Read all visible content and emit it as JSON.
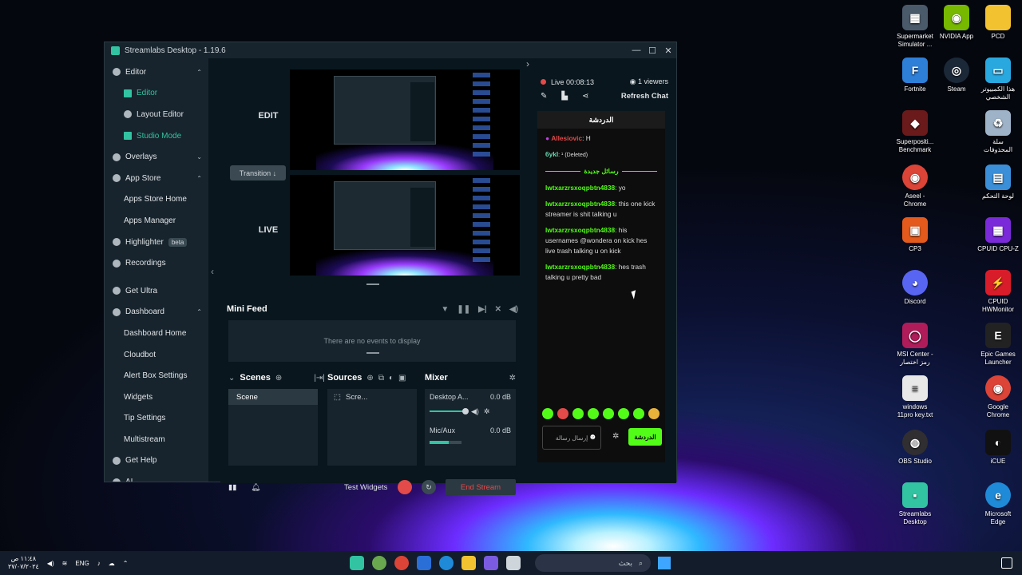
{
  "window": {
    "title": "Streamlabs Desktop - 1.19.6",
    "controls": [
      "—",
      "☐",
      "✕"
    ]
  },
  "sidebar": {
    "items": [
      {
        "label": "Editor",
        "level": 0,
        "caret": "⌃"
      },
      {
        "label": "Editor",
        "level": 1,
        "active": true
      },
      {
        "label": "Layout Editor",
        "level": 1
      },
      {
        "label": "Studio Mode",
        "level": 1,
        "active": true
      },
      {
        "label": "Overlays",
        "level": 0,
        "caret": "⌄"
      },
      {
        "label": "App Store",
        "level": 0,
        "caret": "⌃"
      },
      {
        "label": "Apps Store Home",
        "level": 1
      },
      {
        "label": "Apps Manager",
        "level": 1
      },
      {
        "label": "Highlighter",
        "level": 0,
        "badge": "beta"
      },
      {
        "label": "Recordings",
        "level": 0
      },
      {
        "label": "Get Ultra",
        "level": 0
      },
      {
        "label": "Dashboard",
        "level": 0,
        "caret": "⌃"
      },
      {
        "label": "Dashboard Home",
        "level": 1
      },
      {
        "label": "Cloudbot",
        "level": 1
      },
      {
        "label": "Alert Box Settings",
        "level": 1
      },
      {
        "label": "Widgets",
        "level": 1
      },
      {
        "label": "Tip Settings",
        "level": 1
      },
      {
        "label": "Multistream",
        "level": 1
      },
      {
        "label": "Get Help",
        "level": 0
      },
      {
        "label": "AI",
        "level": 0
      }
    ]
  },
  "studio": {
    "edit_label": "EDIT",
    "live_label": "LIVE",
    "transition_label": "Transition ↓"
  },
  "minifeed": {
    "title": "Mini Feed",
    "empty_text": "There are no events to display"
  },
  "scenes": {
    "title": "Scenes",
    "items": [
      "Scene"
    ]
  },
  "sources": {
    "title": "Sources",
    "items": [
      "Scre..."
    ]
  },
  "mixer": {
    "title": "Mixer",
    "channels": [
      {
        "name": "Desktop A...",
        "db": "0.0 dB"
      },
      {
        "name": "Mic/Aux",
        "db": "0.0 dB"
      }
    ]
  },
  "footer": {
    "test_widgets": "Test Widgets",
    "end_stream": "End Stream"
  },
  "chat": {
    "live_text": "Live 00:08:13",
    "viewers": "1 viewers",
    "refresh": "Refresh Chat",
    "header": "الدردشة",
    "messages": [
      {
        "user": "Allesiovic",
        "text": ": H",
        "color": "red"
      },
      {
        "user": "6ykl",
        "text": ": ¹ (Deleted)",
        "color": "teal"
      },
      {
        "user": "lwtxarzrsxoqpbtn4838",
        "text": ": yo"
      },
      {
        "user": "lwtxarzrsxoqpbtn4838",
        "text": ": this one kick streamer is shit talking u"
      },
      {
        "user": "lwtxarzrsxoqpbtn4838",
        "text": ": his usernames @wondera on kick hes live trash talking u on kick"
      },
      {
        "user": "lwtxarzrsxoqpbtn4838",
        "text": ": hes trash talking u pretty bad"
      }
    ],
    "new_messages_divider": "رسائل جديدة",
    "input_placeholder": "إرسال رسالة",
    "send_label": "الدردشة"
  },
  "desktop_icons": [
    {
      "label": "Supermarket Simulator ...",
      "color": "#4a5a6a"
    },
    {
      "label": "NVIDIA App",
      "color": "#76b900"
    },
    {
      "label": "PCD",
      "color": "#f2c230"
    },
    {
      "label": "Fortnite",
      "color": "#2d7fd8"
    },
    {
      "label": "Steam",
      "color": "#1b2838"
    },
    {
      "label": "هذا الكمبيوتر الشخصي",
      "color": "#29a8e0"
    },
    {
      "label": "Superpositi... Benchmark",
      "color": "#6a1a1a"
    },
    {
      "label": "سلة المحذوفات",
      "color": "#9fb3c8"
    },
    {
      "label": "Aseel - Chrome",
      "color": "#db4437"
    },
    {
      "label": "لوحة التحكم",
      "color": "#3a8fd8"
    },
    {
      "label": "CP3",
      "color": "#e35a1c"
    },
    {
      "label": "CPUID CPU-Z",
      "color": "#7a2ad8"
    },
    {
      "label": "Discord",
      "color": "#5865f2"
    },
    {
      "label": "CPUID HWMonitor",
      "color": "#d81c2a"
    },
    {
      "label": "MSI Center - رمز اختصار",
      "color": "#b01c5a"
    },
    {
      "label": "Epic Games Launcher",
      "color": "#222222"
    },
    {
      "label": "windows 11pro key.txt",
      "color": "#e8e8e8"
    },
    {
      "label": "Google Chrome",
      "color": "#db4437"
    },
    {
      "label": "OBS Studio",
      "color": "#302e31"
    },
    {
      "label": "iCUE",
      "color": "#111111"
    },
    {
      "label": "Streamlabs Desktop",
      "color": "#31c3a2"
    },
    {
      "label": "Microsoft Edge",
      "color": "#1f8ad8"
    }
  ],
  "taskbar": {
    "time": "١١:٤٨ ص",
    "date": "٢٧/٠٧/٢٠٢٤",
    "lang": "ENG",
    "search_placeholder": "بحث"
  }
}
